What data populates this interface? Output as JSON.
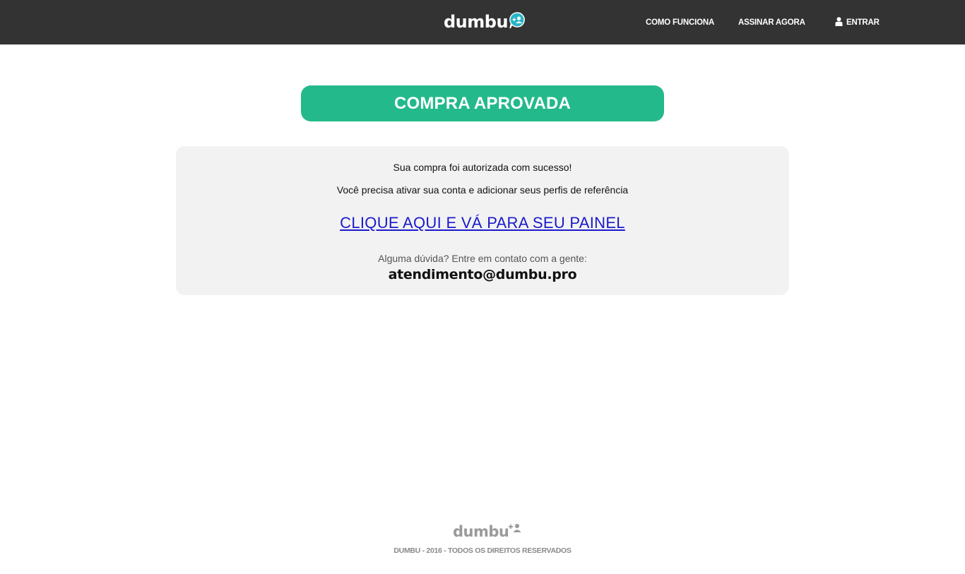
{
  "header": {
    "logo_text": "dumbu",
    "nav": {
      "como_funciona": "COMO FUNCIONA",
      "assinar_agora": "ASSINAR AGORA",
      "entrar": "ENTRAR"
    }
  },
  "banner": {
    "status": "COMPRA APROVADA"
  },
  "message": {
    "line1": "Sua compra foi autorizada com sucesso!",
    "line2": "Você precisa ativar sua conta e adicionar seus perfis de referência",
    "panel_link": "CLIQUE AQUI E VÁ PARA SEU PAINEL",
    "help_text": "Alguma dúvida? Entre em contato com a gente:",
    "support_email": "atendimento@dumbu.pro"
  },
  "footer": {
    "logo_text": "dumbu",
    "copyright": "DUMBU - 2016 - TODOS OS DIREITOS RESERVADOS"
  },
  "colors": {
    "topbar": "#333333",
    "accent_green": "#23b98b",
    "logo_icon": "#26b5c6",
    "link_blue": "#1a1acc"
  },
  "icons": [
    "add-user-bubble-icon",
    "user-icon",
    "add-user-icon"
  ]
}
